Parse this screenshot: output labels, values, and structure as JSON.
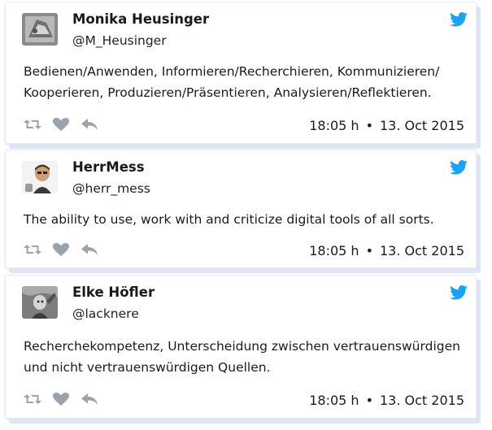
{
  "colors": {
    "bird": "#1da1f2",
    "action_icons": "#9aa3ad"
  },
  "tweets": [
    {
      "name": "Monika Heusinger",
      "handle": "@M_Heusinger",
      "text": "Bedienen/Anwenden, Informieren/Recherchieren, Kommunizieren/ Kooperieren, Produzieren/Präsentieren, Analysieren/Reflektieren.",
      "time": "18:05 h",
      "date": "13. Oct 2015",
      "separator": "•"
    },
    {
      "name": "HerrMess",
      "handle": "@herr_mess",
      "text": "The ability to use, work with and criticize digital tools of all sorts.",
      "time": "18:05 h",
      "date": "13. Oct 2015",
      "separator": "•"
    },
    {
      "name": "Elke Höfler",
      "handle": "@lacknere",
      "text": "Recherchekompetenz, Unterscheidung zwischen vertrauenswürdigen und nicht vertrauenswürdigen Quellen.",
      "time": "18:05 h",
      "date": "13. Oct 2015",
      "separator": "•"
    }
  ],
  "icons": {
    "bird": "twitter-bird-icon",
    "retweet": "retweet-icon",
    "like": "heart-icon",
    "reply": "reply-icon"
  }
}
